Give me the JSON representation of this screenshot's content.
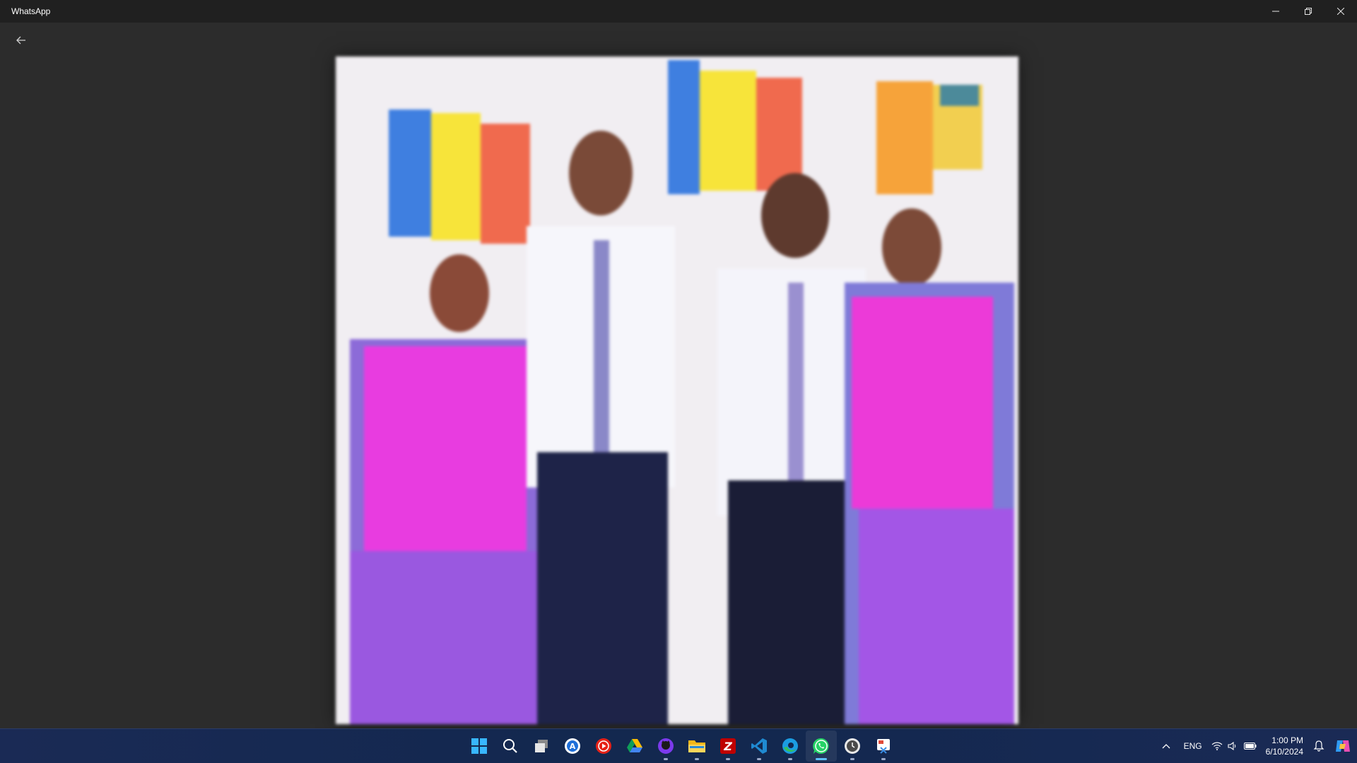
{
  "window": {
    "title": "WhatsApp"
  },
  "controls": {
    "minimize": "minimize",
    "restore": "restore",
    "close": "close"
  },
  "viewer": {
    "back_icon": "back-arrow-icon"
  },
  "taskbar": {
    "apps": [
      {
        "name": "start",
        "icon": "windows-start-icon",
        "running": false
      },
      {
        "name": "search",
        "icon": "search-icon",
        "running": false
      },
      {
        "name": "task-view",
        "icon": "task-view-icon",
        "running": false
      },
      {
        "name": "app-a",
        "icon": "blue-a-app-icon",
        "running": false
      },
      {
        "name": "youtube",
        "icon": "youtube-icon",
        "running": false
      },
      {
        "name": "google-drive",
        "icon": "google-drive-icon",
        "running": false
      },
      {
        "name": "github",
        "icon": "github-icon",
        "running": true
      },
      {
        "name": "file-explorer",
        "icon": "file-explorer-icon",
        "running": true
      },
      {
        "name": "filezilla",
        "icon": "filezilla-icon",
        "running": true
      },
      {
        "name": "vscode",
        "icon": "vscode-icon",
        "running": true
      },
      {
        "name": "edge",
        "icon": "edge-icon",
        "running": true
      },
      {
        "name": "whatsapp",
        "icon": "whatsapp-icon",
        "running": true,
        "active": true
      },
      {
        "name": "clock-app",
        "icon": "clock-app-icon",
        "running": true
      },
      {
        "name": "snipping-tool",
        "icon": "snipping-tool-icon",
        "running": true
      }
    ],
    "tray": {
      "language": "ENG",
      "time": "1:00 PM",
      "date": "6/10/2024"
    }
  },
  "colors": {
    "titlebar": "#202020",
    "viewer_bg": "#2c2c2c",
    "taskbar": "#13284f",
    "whatsapp": "#25d366"
  }
}
